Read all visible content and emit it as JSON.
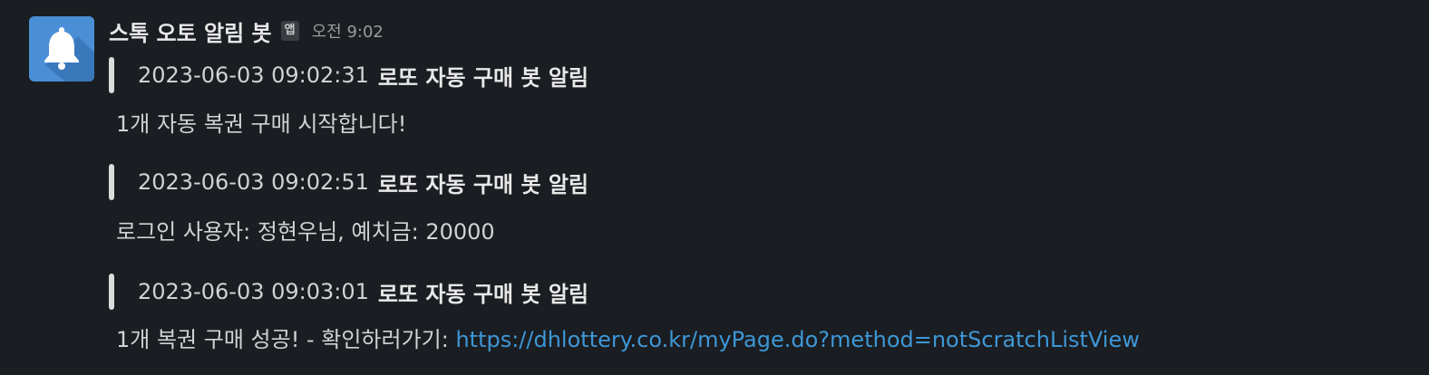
{
  "message": {
    "avatar_icon": "bell-icon",
    "sender": "스톡 오토 알림 봇",
    "app_badge": "앱",
    "time": "오전 9:02"
  },
  "attachments": [
    {
      "date": "2023-06-03 09:02:31",
      "title": "로또 자동 구매 봇 알림",
      "text": "1개 자동 복권 구매 시작합니다!"
    },
    {
      "date": "2023-06-03 09:02:51",
      "title": "로또 자동 구매 봇 알림",
      "text": "로그인 사용자: 정현우님, 예치금: 20000"
    },
    {
      "date": "2023-06-03 09:03:01",
      "title": "로또 자동 구매 봇 알림",
      "text": "1개 복권 구매 성공! - 확인하러가기: ",
      "link": "https://dhlottery.co.kr/myPage.do?method=notScratchListView"
    }
  ],
  "colors": {
    "background": "#1a1d21",
    "avatar": "#4a8fd6",
    "link": "#3e97d6",
    "quote_bar": "#dcdcdc"
  }
}
